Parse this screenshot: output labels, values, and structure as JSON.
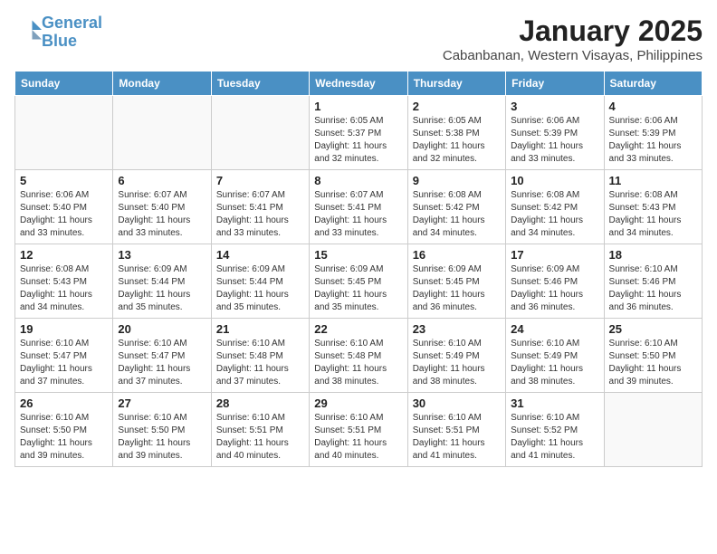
{
  "logo": {
    "line1": "General",
    "line2": "Blue"
  },
  "title": "January 2025",
  "subtitle": "Cabanbanan, Western Visayas, Philippines",
  "weekdays": [
    "Sunday",
    "Monday",
    "Tuesday",
    "Wednesday",
    "Thursday",
    "Friday",
    "Saturday"
  ],
  "weeks": [
    [
      {
        "day": "",
        "info": ""
      },
      {
        "day": "",
        "info": ""
      },
      {
        "day": "",
        "info": ""
      },
      {
        "day": "1",
        "info": "Sunrise: 6:05 AM\nSunset: 5:37 PM\nDaylight: 11 hours\nand 32 minutes."
      },
      {
        "day": "2",
        "info": "Sunrise: 6:05 AM\nSunset: 5:38 PM\nDaylight: 11 hours\nand 32 minutes."
      },
      {
        "day": "3",
        "info": "Sunrise: 6:06 AM\nSunset: 5:39 PM\nDaylight: 11 hours\nand 33 minutes."
      },
      {
        "day": "4",
        "info": "Sunrise: 6:06 AM\nSunset: 5:39 PM\nDaylight: 11 hours\nand 33 minutes."
      }
    ],
    [
      {
        "day": "5",
        "info": "Sunrise: 6:06 AM\nSunset: 5:40 PM\nDaylight: 11 hours\nand 33 minutes."
      },
      {
        "day": "6",
        "info": "Sunrise: 6:07 AM\nSunset: 5:40 PM\nDaylight: 11 hours\nand 33 minutes."
      },
      {
        "day": "7",
        "info": "Sunrise: 6:07 AM\nSunset: 5:41 PM\nDaylight: 11 hours\nand 33 minutes."
      },
      {
        "day": "8",
        "info": "Sunrise: 6:07 AM\nSunset: 5:41 PM\nDaylight: 11 hours\nand 33 minutes."
      },
      {
        "day": "9",
        "info": "Sunrise: 6:08 AM\nSunset: 5:42 PM\nDaylight: 11 hours\nand 34 minutes."
      },
      {
        "day": "10",
        "info": "Sunrise: 6:08 AM\nSunset: 5:42 PM\nDaylight: 11 hours\nand 34 minutes."
      },
      {
        "day": "11",
        "info": "Sunrise: 6:08 AM\nSunset: 5:43 PM\nDaylight: 11 hours\nand 34 minutes."
      }
    ],
    [
      {
        "day": "12",
        "info": "Sunrise: 6:08 AM\nSunset: 5:43 PM\nDaylight: 11 hours\nand 34 minutes."
      },
      {
        "day": "13",
        "info": "Sunrise: 6:09 AM\nSunset: 5:44 PM\nDaylight: 11 hours\nand 35 minutes."
      },
      {
        "day": "14",
        "info": "Sunrise: 6:09 AM\nSunset: 5:44 PM\nDaylight: 11 hours\nand 35 minutes."
      },
      {
        "day": "15",
        "info": "Sunrise: 6:09 AM\nSunset: 5:45 PM\nDaylight: 11 hours\nand 35 minutes."
      },
      {
        "day": "16",
        "info": "Sunrise: 6:09 AM\nSunset: 5:45 PM\nDaylight: 11 hours\nand 36 minutes."
      },
      {
        "day": "17",
        "info": "Sunrise: 6:09 AM\nSunset: 5:46 PM\nDaylight: 11 hours\nand 36 minutes."
      },
      {
        "day": "18",
        "info": "Sunrise: 6:10 AM\nSunset: 5:46 PM\nDaylight: 11 hours\nand 36 minutes."
      }
    ],
    [
      {
        "day": "19",
        "info": "Sunrise: 6:10 AM\nSunset: 5:47 PM\nDaylight: 11 hours\nand 37 minutes."
      },
      {
        "day": "20",
        "info": "Sunrise: 6:10 AM\nSunset: 5:47 PM\nDaylight: 11 hours\nand 37 minutes."
      },
      {
        "day": "21",
        "info": "Sunrise: 6:10 AM\nSunset: 5:48 PM\nDaylight: 11 hours\nand 37 minutes."
      },
      {
        "day": "22",
        "info": "Sunrise: 6:10 AM\nSunset: 5:48 PM\nDaylight: 11 hours\nand 38 minutes."
      },
      {
        "day": "23",
        "info": "Sunrise: 6:10 AM\nSunset: 5:49 PM\nDaylight: 11 hours\nand 38 minutes."
      },
      {
        "day": "24",
        "info": "Sunrise: 6:10 AM\nSunset: 5:49 PM\nDaylight: 11 hours\nand 38 minutes."
      },
      {
        "day": "25",
        "info": "Sunrise: 6:10 AM\nSunset: 5:50 PM\nDaylight: 11 hours\nand 39 minutes."
      }
    ],
    [
      {
        "day": "26",
        "info": "Sunrise: 6:10 AM\nSunset: 5:50 PM\nDaylight: 11 hours\nand 39 minutes."
      },
      {
        "day": "27",
        "info": "Sunrise: 6:10 AM\nSunset: 5:50 PM\nDaylight: 11 hours\nand 39 minutes."
      },
      {
        "day": "28",
        "info": "Sunrise: 6:10 AM\nSunset: 5:51 PM\nDaylight: 11 hours\nand 40 minutes."
      },
      {
        "day": "29",
        "info": "Sunrise: 6:10 AM\nSunset: 5:51 PM\nDaylight: 11 hours\nand 40 minutes."
      },
      {
        "day": "30",
        "info": "Sunrise: 6:10 AM\nSunset: 5:51 PM\nDaylight: 11 hours\nand 41 minutes."
      },
      {
        "day": "31",
        "info": "Sunrise: 6:10 AM\nSunset: 5:52 PM\nDaylight: 11 hours\nand 41 minutes."
      },
      {
        "day": "",
        "info": ""
      }
    ]
  ],
  "shaded_rows": [
    1,
    3
  ]
}
